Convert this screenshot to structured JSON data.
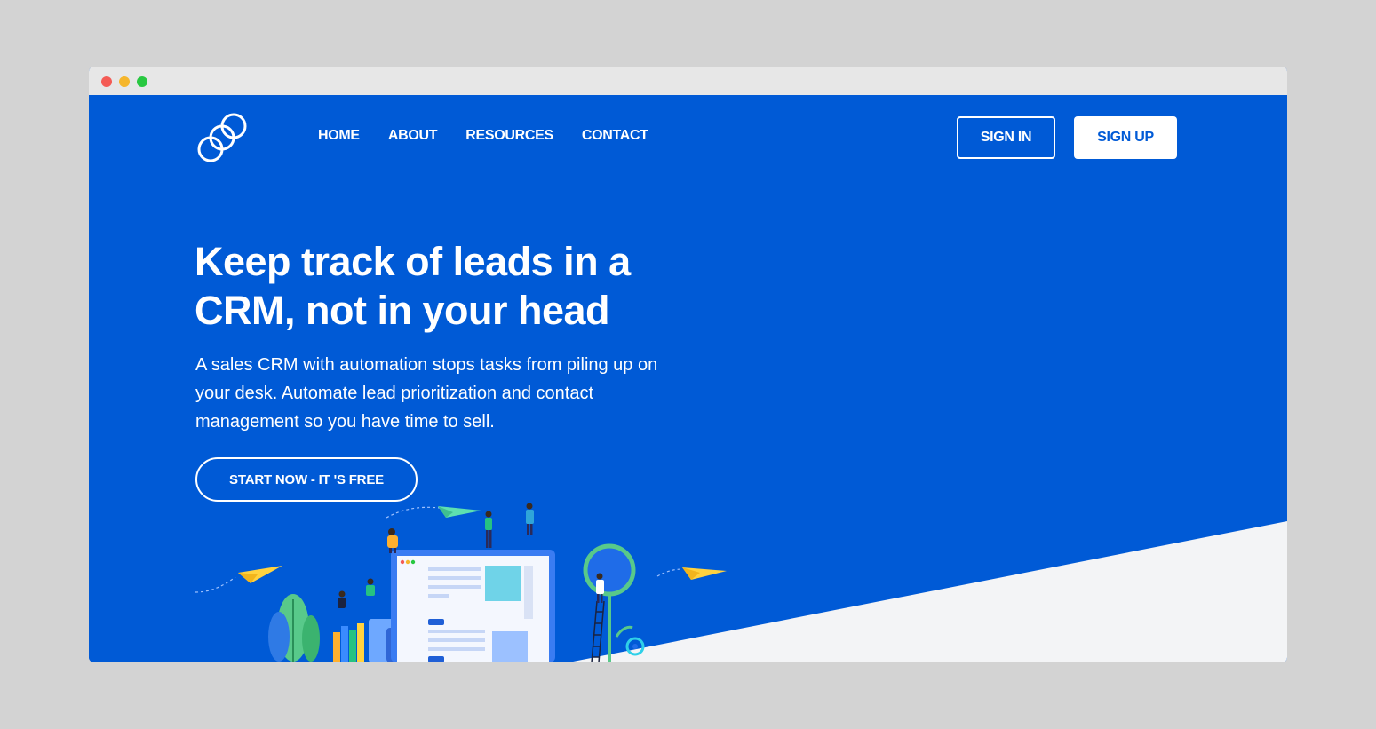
{
  "nav": {
    "items": [
      {
        "label": "HOME"
      },
      {
        "label": "ABOUT"
      },
      {
        "label": "RESOURCES"
      },
      {
        "label": "CONTACT"
      }
    ]
  },
  "header": {
    "sign_in_label": "SIGN IN",
    "sign_up_label": "SIGN UP"
  },
  "hero": {
    "headline": "Keep track of leads in a CRM, not in your head",
    "subtext": "A sales CRM with automation stops tasks from piling up on your desk. Automate lead prioritization and contact management so you have time to sell.",
    "cta_label": "START NOW - IT 'S FREE"
  },
  "icons": {
    "logo": "interlocking-rings-logo-icon",
    "window_controls": [
      "close-dot-icon",
      "minimize-dot-icon",
      "maximize-dot-icon"
    ]
  },
  "colors": {
    "brand_blue": "#005ad6",
    "background_gray": "#d3d3d3",
    "slant_gray": "#f3f4f6",
    "white": "#ffffff"
  }
}
